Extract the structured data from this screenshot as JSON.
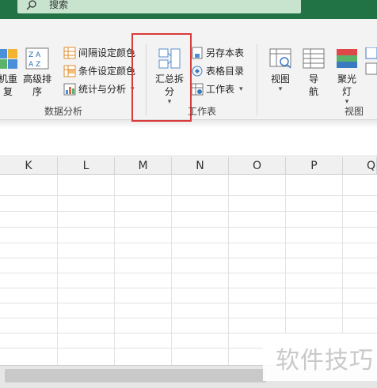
{
  "search": {
    "label": "搜索"
  },
  "ribbon": {
    "partial_left": {
      "line1": "机重",
      "line2": "复"
    },
    "sort_button": {
      "line1": "高级排",
      "line2": "序"
    },
    "data_analysis": {
      "items": [
        "间隔设定颜色",
        "条件设定颜色",
        "统计与分析"
      ],
      "group_label": "数据分析"
    },
    "worksheet": {
      "merge_split": {
        "line1": "汇总拆",
        "line2": "分"
      },
      "items": [
        "另存本表",
        "表格目录",
        "工作表"
      ],
      "group_label": "工作表"
    },
    "view": {
      "buttons": [
        {
          "line1": "视图",
          "line2": ""
        },
        {
          "line1": "导",
          "line2": "航"
        },
        {
          "line1": "聚光",
          "line2": "灯"
        }
      ],
      "group_label": "视图"
    }
  },
  "columns": [
    "K",
    "L",
    "M",
    "N",
    "O",
    "P",
    "Q"
  ],
  "watermark": "软件技巧",
  "colors": {
    "title_bar": "#217346",
    "highlight": "#d93a3a"
  }
}
